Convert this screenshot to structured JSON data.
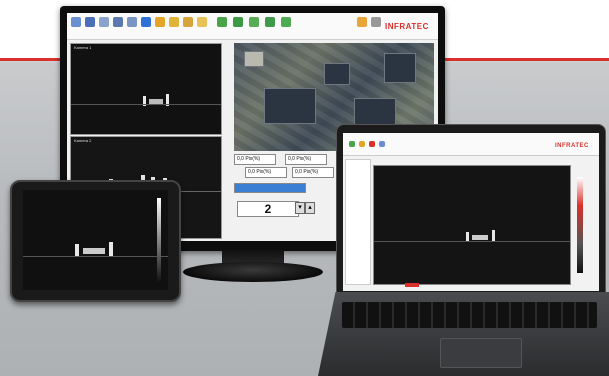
{
  "brand": {
    "name": "INFRATEC",
    "color": "#d9302b"
  },
  "monitor": {
    "camera_labels": [
      "Kamera 1",
      "Kamera 2"
    ],
    "controls": {
      "value_1": "0,0 Pix(%)",
      "value_2": "0,0 Pix(%)",
      "value_3": "0,0 Pix(%)",
      "value_4": "0,0 Pix(%)",
      "counter": "2"
    }
  }
}
